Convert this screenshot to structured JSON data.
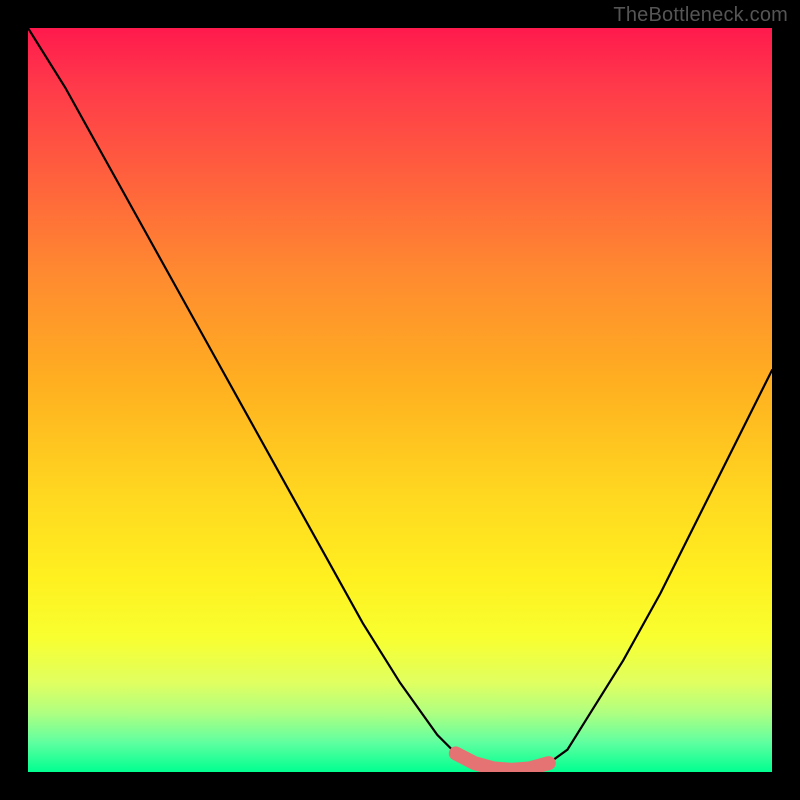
{
  "watermark": "TheBottleneck.com",
  "chart_data": {
    "type": "line",
    "title": "",
    "xlabel": "",
    "ylabel": "",
    "xlim": [
      0,
      1
    ],
    "ylim": [
      0,
      1
    ],
    "series": [
      {
        "name": "bottleneck-curve",
        "x": [
          0.0,
          0.05,
          0.1,
          0.15,
          0.2,
          0.25,
          0.3,
          0.35,
          0.4,
          0.45,
          0.5,
          0.55,
          0.575,
          0.6,
          0.625,
          0.65,
          0.675,
          0.7,
          0.725,
          0.75,
          0.8,
          0.85,
          0.9,
          0.95,
          1.0
        ],
        "y": [
          1.0,
          0.92,
          0.83,
          0.74,
          0.65,
          0.56,
          0.47,
          0.38,
          0.29,
          0.2,
          0.12,
          0.05,
          0.025,
          0.012,
          0.005,
          0.003,
          0.005,
          0.012,
          0.03,
          0.07,
          0.15,
          0.24,
          0.34,
          0.44,
          0.54
        ]
      }
    ],
    "highlight": {
      "name": "optimal-zone",
      "xrange": [
        0.56,
        0.72
      ],
      "yrange": [
        0.0,
        0.03
      ]
    },
    "background_gradient": {
      "orientation": "vertical",
      "stops": [
        {
          "pos": 0.0,
          "color": "#ff1a4d"
        },
        {
          "pos": 0.33,
          "color": "#ff8a30"
        },
        {
          "pos": 0.63,
          "color": "#ffd820"
        },
        {
          "pos": 0.88,
          "color": "#e0ff60"
        },
        {
          "pos": 1.0,
          "color": "#00ff90"
        }
      ]
    }
  }
}
